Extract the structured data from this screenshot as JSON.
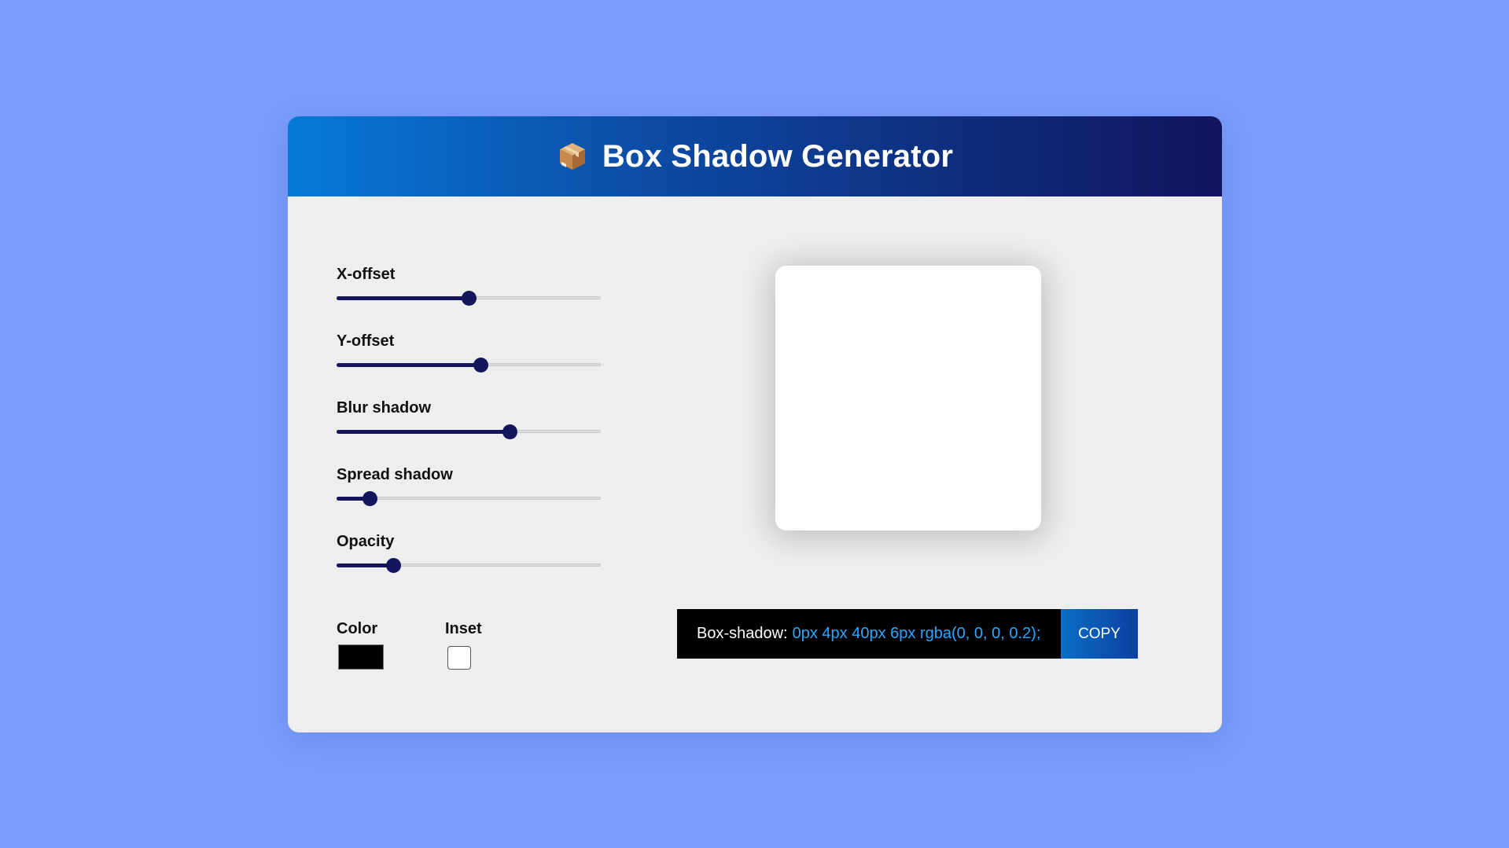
{
  "header": {
    "icon": "package-icon",
    "title": "Box Shadow Generator"
  },
  "controls": [
    {
      "label": "X-offset",
      "value_fraction": 0.5
    },
    {
      "label": "Y-offset",
      "value_fraction": 0.545
    },
    {
      "label": "Blur shadow",
      "value_fraction": 0.655
    },
    {
      "label": "Spread shadow",
      "value_fraction": 0.125
    },
    {
      "label": "Opacity",
      "value_fraction": 0.215
    }
  ],
  "color": {
    "label": "Color",
    "value": "#000000"
  },
  "inset": {
    "label": "Inset",
    "checked": false
  },
  "output": {
    "prefix": "Box-shadow:",
    "value": "0px 4px 40px 6px rgba(0, 0, 0, 0.2);",
    "copy_label": "COPY"
  },
  "colors": {
    "background": "#7b9cfc",
    "accent": "#15155c",
    "code_value": "#2aa8ff"
  }
}
